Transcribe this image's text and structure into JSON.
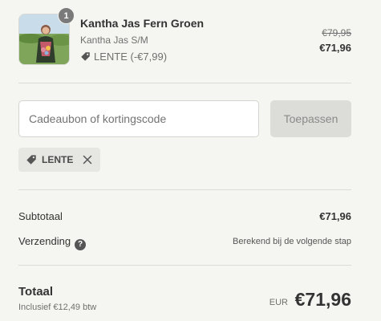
{
  "product": {
    "quantity": "1",
    "name": "Kantha Jas Fern Groen",
    "variant": "Kantha Jas S/M",
    "discount_label": "LENTE (-€7,99)",
    "original_price": "€79,95",
    "price": "€71,96",
    "image_icon": "product-photo"
  },
  "discount": {
    "placeholder": "Cadeaubon of kortingscode",
    "apply_label": "Toepassen",
    "applied_code": "LENTE"
  },
  "summary": {
    "subtotal_label": "Subtotaal",
    "subtotal_value": "€71,96",
    "shipping_label": "Verzending",
    "shipping_value": "Berekend bij de volgende stap",
    "total_label": "Totaal",
    "tax_note": "Inclusief €12,49 btw",
    "currency": "EUR",
    "total_value": "€71,96"
  },
  "colors": {
    "background": "#f5f5f1",
    "text": "#333333",
    "muted": "#707070",
    "button_disabled": "#dcdcd8"
  }
}
